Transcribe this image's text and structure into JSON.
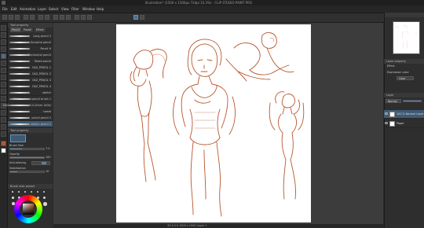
{
  "window": {
    "title": "Illustration* (1500 x 1500px 72dpi 33.3%) - CLIP STUDIO PAINT PRO"
  },
  "menu": {
    "items": [
      "File",
      "Edit",
      "Animation",
      "Layer",
      "Select",
      "View",
      "Filter",
      "Window",
      "Help"
    ]
  },
  "tool_property": {
    "header": "Tool property",
    "tabs": [
      "Pencil",
      "Pastel",
      "Effect"
    ],
    "brush_size_label": "Brush Size",
    "brush_size_value": "7.0",
    "opacity_label": "Opacity",
    "opacity_value": "100",
    "opacity_fraction": 1.0,
    "anti_alias_label": "Anti-aliasing",
    "stabilization_label": "Stabilization",
    "stabilization_value": "10",
    "stabilization_fraction": 0.2
  },
  "brushes": [
    {
      "label": "Long pencil 2"
    },
    {
      "label": "Gouache pencil"
    },
    {
      "label": "Pencil H"
    },
    {
      "label": "Mechanical pencil"
    },
    {
      "label": "Bleed pencil"
    },
    {
      "label": "OAZ_PENCIL 1"
    },
    {
      "label": "OAZ_PENCIL 2"
    },
    {
      "label": "OAZ_PENCIL 3"
    },
    {
      "label": "OAZ_PENCIL 4"
    },
    {
      "label": "sketch"
    },
    {
      "label": "White colored pencil brush 1"
    },
    {
      "label": "White doubledrawn 0.4 (5mm 140k)"
    },
    {
      "label": "tweet"
    },
    {
      "label": "pencil pencil 2"
    },
    {
      "label": "sketch pencil 1"
    }
  ],
  "selected_brush_index": 14,
  "brush_sizes_panel": {
    "header": "Brush size preset"
  },
  "layer_property": {
    "header": "Layer property",
    "effect_label": "Effect",
    "expression_color_label": "Expression color",
    "expression_color_value": "Color"
  },
  "layers_panel": {
    "header": "Layer",
    "blend_mode": "Normal",
    "opacity": "100",
    "layers": [
      {
        "name": "100 % Normal Layer 1",
        "selected": true
      },
      {
        "name": "Paper",
        "selected": false
      }
    ]
  },
  "status": {
    "text": "33.3   0.0   1500 x 1500   Layer 1"
  },
  "colors": {
    "sketch": "#b8572f",
    "accent": "#4a6d8c",
    "selected_row": "#3f5a74",
    "current_color": "#b8572f"
  },
  "icons": [
    "app-icon",
    "pen-tool-icon",
    "eraser-icon",
    "move-icon",
    "lasso-icon",
    "fill-icon",
    "eye-icon",
    "color-wheel-icon"
  ]
}
